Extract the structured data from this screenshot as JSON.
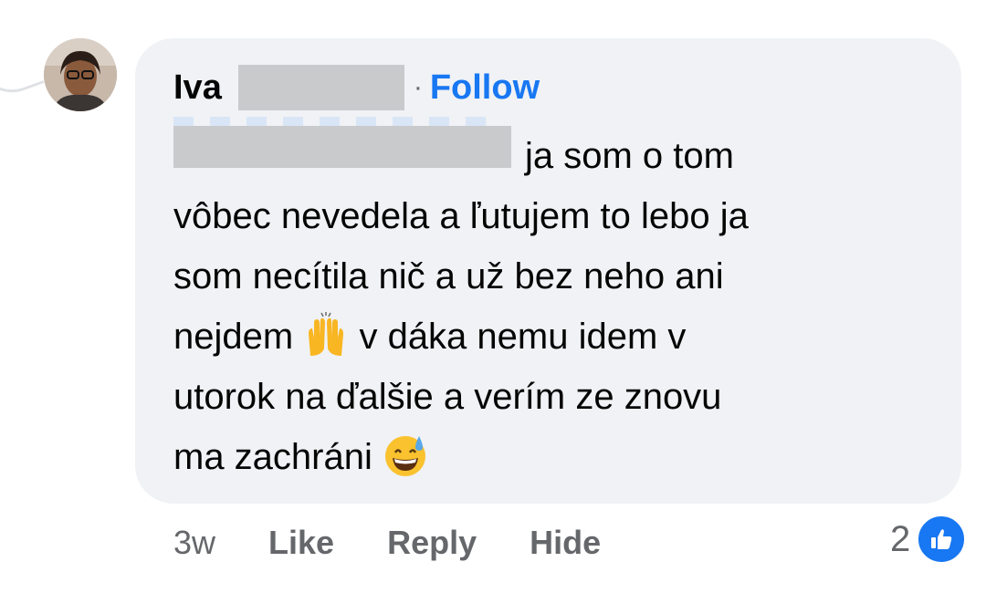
{
  "comment": {
    "author_first_name": "Iva",
    "follow_label": "Follow",
    "separator": "·",
    "lines": [
      "ja som o tom",
      "vôbec nevedela a ľutujem to lebo ja",
      "som necítila nič a už bez neho ani",
      "v dáka nemu idem v",
      "utorok na ďalšie a verím ze znovu",
      "ma zachráni"
    ],
    "line4_prefix": "nejdem",
    "emoji_1": "raising-hands",
    "emoji_2": "grinning-sweat"
  },
  "footer": {
    "timestamp": "3w",
    "like_label": "Like",
    "reply_label": "Reply",
    "hide_label": "Hide",
    "reaction_count": "2",
    "reaction_icon": "like-icon"
  },
  "colors": {
    "bubble": "#f0f2f5",
    "accent": "#1877f2",
    "text": "#050505",
    "muted": "#65676b",
    "redaction": "#c9cacc"
  }
}
